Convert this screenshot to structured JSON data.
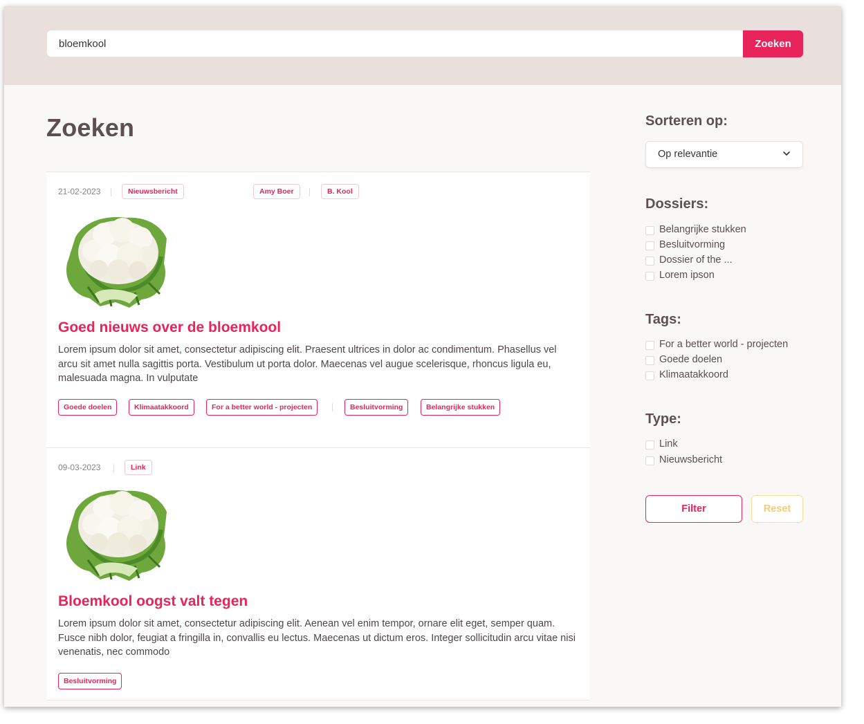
{
  "search": {
    "value": "bloemkool",
    "button_label": "Zoeken"
  },
  "page": {
    "title": "Zoeken"
  },
  "results": [
    {
      "date": "21-02-2023",
      "type": "Nieuwsbericht",
      "authors": [
        "Amy Boer",
        "B. Kool"
      ],
      "title": "Goed nieuws over de bloemkool",
      "body": "Lorem ipsum dolor sit amet, consectetur adipiscing elit. Praesent ultrices in dolor ac condimentum. Phasellus vel arcu sit amet nulla sagittis porta. Vestibulum ut porta dolor. Maecenas vel augue scelerisque, rhoncus ligula eu, malesuada magna. In vulputate",
      "tags": [
        "Goede doelen",
        "Klimaatakkoord",
        "For a better world - projecten"
      ],
      "dossiers": [
        "Besluitvorming",
        "Belangrijke stukken"
      ]
    },
    {
      "date": "09-03-2023",
      "type": "Link",
      "title": "Bloemkool oogst valt tegen",
      "body": "Lorem ipsum dolor sit amet, consectetur adipiscing elit. Aenean vel enim tempor, ornare elit eget, semper quam. Fusce nibh dolor, feugiat a fringilla in, convallis eu lectus. Maecenas ut dictum eros. Integer sollicitudin arcu vitae nisi venenatis, nec commodo",
      "dossiers": [
        "Besluitvorming"
      ]
    }
  ],
  "sidebar": {
    "sort": {
      "heading": "Sorteren op:",
      "selected": "Op relevantie"
    },
    "dossiers": {
      "heading": "Dossiers:",
      "options": [
        "Belangrijke stukken",
        "Besluitvorming",
        "Dossier of the ...",
        "Lorem ipson"
      ]
    },
    "tags": {
      "heading": "Tags:",
      "options": [
        "For a better world - projecten",
        "Goede doelen",
        "Klimaatakkoord"
      ]
    },
    "type": {
      "heading": "Type:",
      "options": [
        "Link",
        "Nieuwsbericht"
      ]
    },
    "filter_label": "Filter",
    "reset_label": "Reset"
  },
  "colors": {
    "accent": "#e8245a",
    "header_band": "#e9dfdd",
    "page_bg": "#faf8f6",
    "reset": "#f6cb75"
  },
  "icons": {
    "sort_select": "chevron-down-icon",
    "result_image": "cauliflower-image"
  }
}
